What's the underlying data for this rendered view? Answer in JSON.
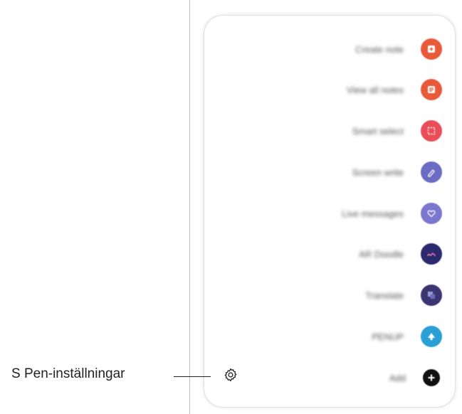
{
  "menu": {
    "items": [
      {
        "label": "Create note",
        "icon": "create-note-icon",
        "color": "#e8593a"
      },
      {
        "label": "View all notes",
        "icon": "notes-list-icon",
        "color": "#e8593a"
      },
      {
        "label": "Smart select",
        "icon": "smart-select-icon",
        "color": "#ea4d58"
      },
      {
        "label": "Screen write",
        "icon": "screen-write-icon",
        "color": "#6c6bc4"
      },
      {
        "label": "Live messages",
        "icon": "heart-icon",
        "color": "#7b77cf"
      },
      {
        "label": "AR Doodle",
        "icon": "ar-doodle-icon",
        "color": "#2c2a6e"
      },
      {
        "label": "Translate",
        "icon": "translate-icon",
        "color": "#3a3470"
      },
      {
        "label": "PENUP",
        "icon": "penup-icon",
        "color": "#2a9fd6"
      },
      {
        "label": "Add",
        "icon": "plus-icon",
        "color": "#111111"
      }
    ]
  },
  "annotation": {
    "label": "S Pen-inställningar",
    "icon": "gear-icon"
  }
}
